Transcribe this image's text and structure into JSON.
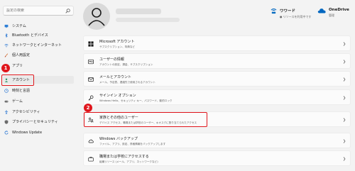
{
  "search": {
    "placeholder": "設定の検索"
  },
  "sidebar": {
    "items": [
      {
        "label": "システム",
        "icon": "monitor-icon"
      },
      {
        "label": "Bluetooth とデバイス",
        "icon": "bluetooth-icon"
      },
      {
        "label": "ネットワークとインターネット",
        "icon": "wifi-icon"
      },
      {
        "label": "個人用設定",
        "icon": "brush-icon"
      },
      {
        "label": "アプリ",
        "icon": "apps-icon"
      },
      {
        "label": "アカウント",
        "icon": "person-icon"
      },
      {
        "label": "時刻と言語",
        "icon": "globe-clock-icon"
      },
      {
        "label": "ゲーム",
        "icon": "gamepad-icon"
      },
      {
        "label": "アクセシビリティ",
        "icon": "accessibility-icon"
      },
      {
        "label": "プライバシーとセキュリティ",
        "icon": "shield-icon"
      },
      {
        "label": "Windows Update",
        "icon": "update-icon"
      }
    ]
  },
  "header": {
    "wireless": {
      "title": "ワワード",
      "subtitle": "● リソースを利用中です"
    },
    "onedrive": {
      "title": "OneDrive",
      "subtitle": "管理"
    }
  },
  "cards": [
    {
      "title": "Microsoft アカウント",
      "subtitle": "サブスクリプション、特典など",
      "icon": "windows-icon"
    },
    {
      "title": "ユーザーの情報",
      "subtitle": "アカウントの設定、課金、サブスクリプション",
      "icon": "user-info-icon"
    },
    {
      "title": "メールとアカウント",
      "subtitle": "メール、予定表、連絡先で使用されるアカウント",
      "icon": "mail-icon"
    },
    {
      "title": "サインイン オプション",
      "subtitle": "Windows Hello、セキュリティ キー、パスワード、動的ロック",
      "icon": "key-icon"
    },
    {
      "title": "家族とその他のユーザー",
      "subtitle": "デバイス アクセス、職場または学校のユーザー、キオスクに割り当てられたアクセス",
      "icon": "family-icon"
    },
    {
      "title": "Windows バックアップ",
      "subtitle": "ファイル、アプリ、設定、資格情報をバックアップします",
      "icon": "backup-icon"
    },
    {
      "title": "職場または学校にアクセスする",
      "subtitle": "組織リソース (メール、アプリ、ネットワークなど)",
      "icon": "briefcase-icon"
    }
  ],
  "annotations": {
    "badge1": "1",
    "badge2": "2"
  },
  "colors": {
    "highlight": "#e0161c",
    "accent": "#0067c0",
    "background": "#f3f3f3"
  }
}
